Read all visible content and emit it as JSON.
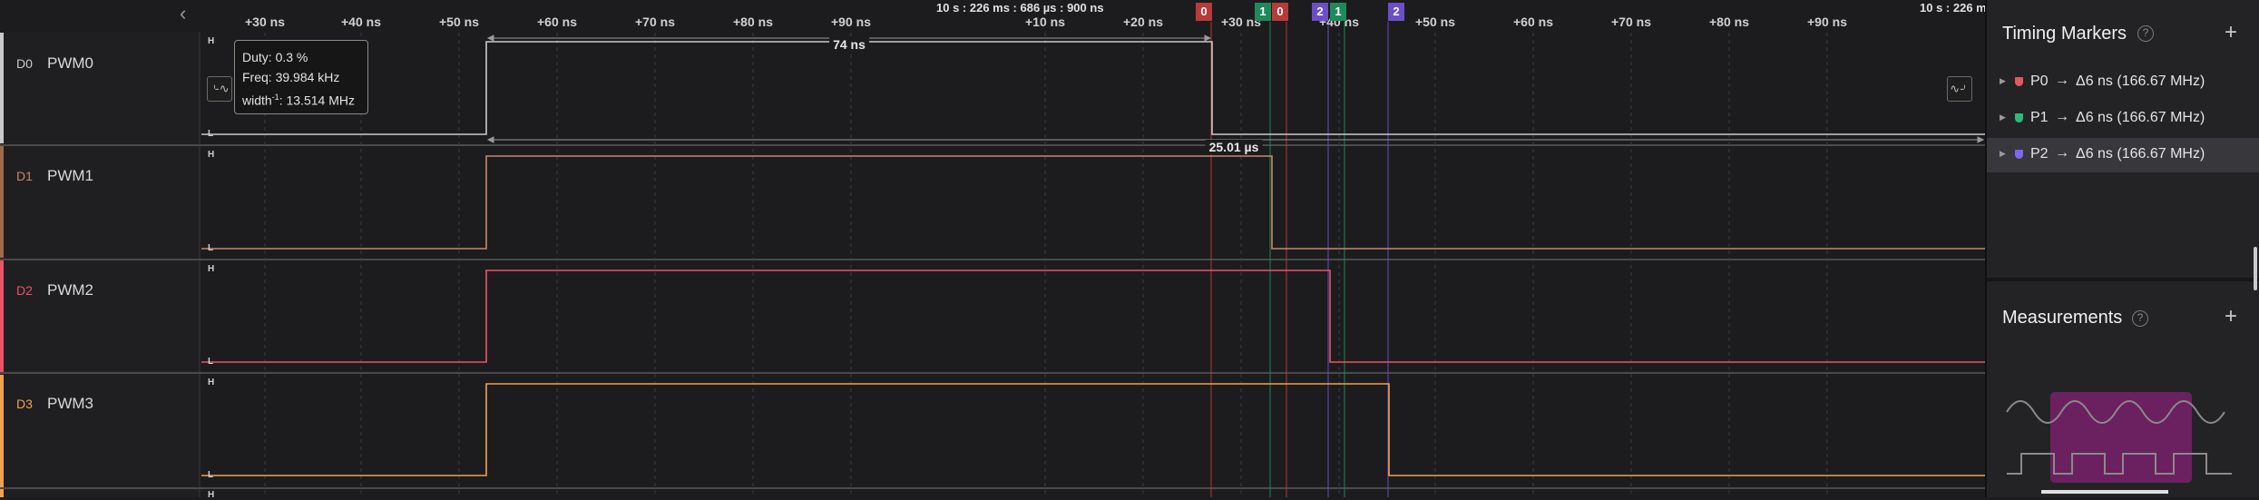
{
  "timeline": {
    "nav_left": "‹",
    "center_timestamp": "10 s : 226 ms : 686 µs : 900 ns",
    "right_timestamp": "10 s : 226 m",
    "ticks": [
      "+30 ns",
      "+40 ns",
      "+50 ns",
      "+60 ns",
      "+70 ns",
      "+80 ns",
      "+90 ns",
      "+10 ns",
      "+20 ns",
      "+30 ns",
      "+40 ns",
      "+50 ns",
      "+60 ns",
      "+70 ns",
      "+80 ns",
      "+90 ns"
    ]
  },
  "channels": [
    {
      "id": "D0",
      "name": "PWM0",
      "color": "#c9c9c9",
      "high": "H",
      "low": "L"
    },
    {
      "id": "D1",
      "name": "PWM1",
      "color": "#c8876a",
      "high": "H",
      "low": "L"
    },
    {
      "id": "D2",
      "name": "PWM2",
      "color": "#e8536a",
      "high": "H",
      "low": "L"
    },
    {
      "id": "D3",
      "name": "PWM3",
      "color": "#f0a24a",
      "high": "H",
      "low": "L"
    },
    {
      "id": "",
      "name": "",
      "color": "#888888",
      "high": "H",
      "low": ""
    }
  ],
  "markers": [
    {
      "label": "0",
      "color": "#b83a3a"
    },
    {
      "label": "1",
      "color": "#1e8a5a"
    },
    {
      "label": "0",
      "color": "#b83a3a"
    },
    {
      "label": "2",
      "color": "#6a4fc8"
    },
    {
      "label": "1",
      "color": "#1e8a5a"
    },
    {
      "label": "2",
      "color": "#6a4fc8"
    }
  ],
  "measurements": {
    "pulse_width": "74 ns",
    "period": "25.01 µs"
  },
  "tooltip": {
    "duty": "Duty: 0.3 %",
    "freq": "Freq: 39.984 kHz",
    "width_prefix": "width",
    "width_sup": "-1",
    "width_value": ": 13.514 MHz"
  },
  "side_buttons": {
    "left": "⌎∿",
    "right": "∿⌏"
  },
  "panel": {
    "timing_title": "Timing Markers",
    "help": "?",
    "add": "+",
    "markers": [
      {
        "name": "P0",
        "arrow": "→",
        "value": "Δ6 ns (166.67 MHz)",
        "color": "#e05a5a",
        "selected": false
      },
      {
        "name": "P1",
        "arrow": "→",
        "value": "Δ6 ns (166.67 MHz)",
        "color": "#2fb87a",
        "selected": false
      },
      {
        "name": "P2",
        "arrow": "→",
        "value": "Δ6 ns (166.67 MHz)",
        "color": "#7b68ee",
        "selected": true
      }
    ],
    "measurements_title": "Measurements",
    "measurements_help": "?",
    "measurements_add": "+"
  }
}
